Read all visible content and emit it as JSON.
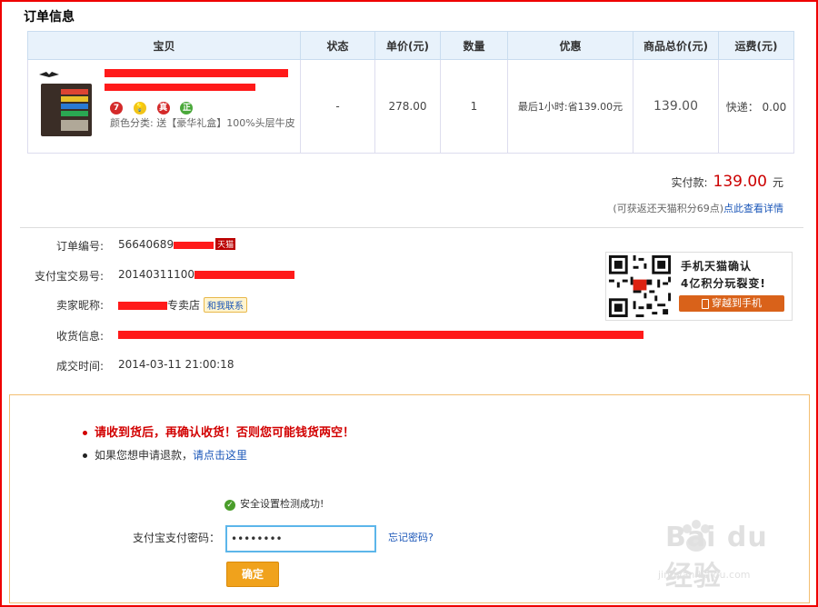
{
  "section_title": "订单信息",
  "table": {
    "headers": [
      "宝贝",
      "状态",
      "单价(元)",
      "数量",
      "优惠",
      "商品总价(元)",
      "运费(元)"
    ],
    "item": {
      "spec": "颜色分类: 送【豪华礼盒】100%头层牛皮",
      "status": "-",
      "unit_price": "278.00",
      "quantity": "1",
      "discount": "最后1小时:省139.00元",
      "total": "139.00",
      "shipping": "快递： 0.00",
      "badges": [
        "7",
        "💡",
        "真",
        "正"
      ]
    }
  },
  "payment": {
    "label": "实付款:",
    "amount": "139.00",
    "unit": "元",
    "points_note": "(可获返还天猫积分69点)",
    "details_link": "点此查看详情"
  },
  "info": {
    "order_no_label": "订单编号:",
    "order_no": "56640689",
    "tmall_tag": "天猫",
    "alipay_no_label": "支付宝交易号:",
    "alipay_no": "20140311100",
    "seller_label": "卖家昵称:",
    "seller_suffix": "专卖店",
    "contact_label": "和我联系",
    "address_label": "收货信息:",
    "time_label": "成交时间:",
    "time": "2014-03-11 21:00:18"
  },
  "mobile": {
    "line1": "手机天猫确认",
    "line2": "4亿积分玩裂变!",
    "button": "穿越到手机"
  },
  "confirm": {
    "warning": "请收到货后，再确认收货！否则您可能钱货两空！",
    "refund_text": "如果您想申请退款，",
    "refund_link": "请点击这里",
    "safety": "安全设置检测成功!",
    "password_label": "支付宝支付密码：",
    "password_value": "••••••••",
    "forgot": "忘记密码?",
    "ok": "确定"
  },
  "watermark": {
    "text": "Bai du 经验",
    "url": "jingyan.baidu.com"
  },
  "colors": {
    "accent_red": "#cc0000",
    "link_blue": "#1a56b8",
    "header_bg": "#e8f2fb",
    "button_orange": "#f0a21c",
    "redaction": "#ff1a1a"
  }
}
